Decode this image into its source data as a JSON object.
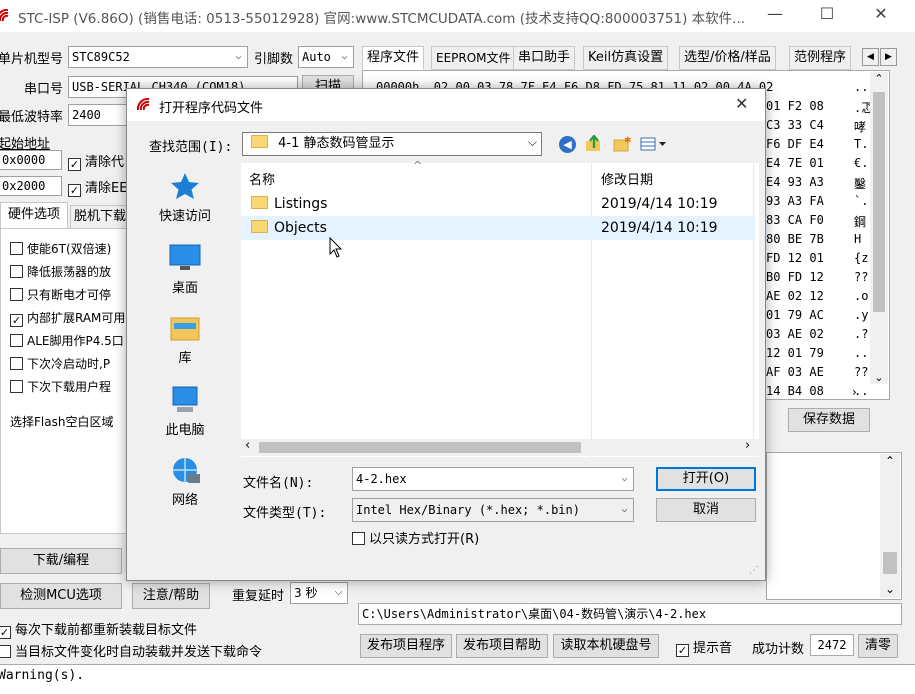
{
  "window": {
    "title": "STC-ISP (V6.86O) (销售电话: 0513-55012928) 官网:www.STCMCUDATA.com  (技术支持QQ:800003751) 本软件...",
    "controls": [
      "—",
      "☐",
      "✕"
    ]
  },
  "left": {
    "mcu_label": "单片机型号",
    "mcu_value": "STC89C52",
    "pins_label": "引脚数",
    "pins_value": "Auto",
    "port_label": "串口号",
    "port_value": "USB-SERIAL CH340 (COM18)",
    "scan_label": "扫描",
    "baud_label": "最低波特率",
    "baud_value": "2400",
    "start_addr_label": "起始地址",
    "addr1": "0x0000",
    "clear1": "清除代",
    "addr2": "0x2000",
    "clear2": "清除EE",
    "hw_tab": "硬件选项",
    "offline_tab": "脱机下载",
    "options": [
      {
        "label": "使能6T(双倍速)",
        "checked": false
      },
      {
        "label": "降低振荡器的放",
        "checked": false
      },
      {
        "label": "只有断电才可停",
        "checked": false
      },
      {
        "label": "内部扩展RAM可用",
        "checked": true
      },
      {
        "label": "ALE脚用作P4.5口",
        "checked": false
      },
      {
        "label": "下次冷启动时,P",
        "checked": false
      },
      {
        "label": "下次下载用户程",
        "checked": false
      }
    ],
    "flash_label": "选择Flash空白区域",
    "download_btn": "下载/编程",
    "detect_btn": "检测MCU选项",
    "help_btn": "注意/帮助",
    "delay_label": "重复延时",
    "delay_value": "3 秒",
    "reload_label": "每次下载前都重新装载目标文件",
    "reload_checked": true,
    "auto_label": "当目标文件变化时自动装载并发送下载命令",
    "auto_checked": false,
    "status_line": "Warning(s)."
  },
  "right": {
    "tabs": [
      "程序文件",
      "EEPROM文件",
      "串口助手",
      "Keil仿真设置",
      "选型/价格/样品",
      "范例程序"
    ],
    "hex_rows": [
      {
        "hex": "00000h  02 00 03 78 7F E4 F6 D8 FD 75 81 11 02 00 4A 02",
        "ascii": "...."
      },
      {
        "hex": "01 F2 08",
        "ascii": ".忑"
      },
      {
        "hex": "C3 33 C4",
        "ascii": "哮"
      },
      {
        "hex": "F6 DF E4",
        "ascii": "T."
      },
      {
        "hex": "E4 7E 01",
        "ascii": "€."
      },
      {
        "hex": "E4 93 A3",
        "ascii": "鑿"
      },
      {
        "hex": "93 A3 FA",
        "ascii": "`."
      },
      {
        "hex": "83 CA F0",
        "ascii": "鋼"
      },
      {
        "hex": "80 BE 7B",
        "ascii": "H"
      },
      {
        "hex": "FD 12 01",
        "ascii": "{z"
      },
      {
        "hex": "B0 FD 12",
        "ascii": "??"
      },
      {
        "hex": "AE 02 12",
        "ascii": ".o"
      },
      {
        "hex": "01 79 AC",
        "ascii": ".y"
      },
      {
        "hex": "03 AE 02",
        "ascii": ".?"
      },
      {
        "hex": "12 01 79",
        "ascii": ".."
      },
      {
        "hex": "AF 03 AE",
        "ascii": "??"
      },
      {
        "hex": "14 B4 08",
        "ascii": ".."
      }
    ],
    "save_data_btn": "保存数据",
    "file_path": "C:\\Users\\Administrator\\桌面\\04-数码管\\演示\\4-2.hex",
    "publish_btn": "发布项目程序",
    "publish_help_btn": "发布项目帮助",
    "read_disk_btn": "读取本机硬盘号",
    "beep_label": "提示音",
    "beep_checked": true,
    "success_label": "成功计数",
    "success_value": "2472",
    "clear_btn": "清零"
  },
  "dialog": {
    "title": "打开程序代码文件",
    "close": "✕",
    "lookin_label": "查找范围(I):",
    "lookin_value": "4-1 静态数码管显示",
    "nav": [
      "快速访问",
      "桌面",
      "库",
      "此电脑",
      "网络"
    ],
    "col_name": "名称",
    "col_date": "修改日期",
    "files": [
      {
        "name": "Listings",
        "date": "2019/4/14 10:19"
      },
      {
        "name": "Objects",
        "date": "2019/4/14 10:19"
      }
    ],
    "filename_label": "文件名(N):",
    "filename_value": "4-2.hex",
    "filetype_label": "文件类型(T):",
    "filetype_value": "Intel Hex/Binary (*.hex; *.bin)",
    "readonly_label": "以只读方式打开(R)",
    "open_btn": "打开(O)",
    "cancel_btn": "取消"
  },
  "colors": {
    "accent": "#0078d7",
    "selection": "#cce8ff",
    "hover": "#e5f3ff"
  }
}
